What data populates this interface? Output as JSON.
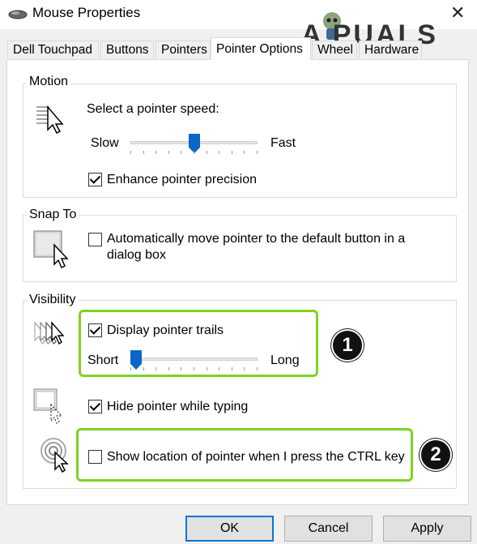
{
  "window": {
    "title": "Mouse Properties",
    "close_glyph": "✕",
    "watermark": "A PUALS"
  },
  "tabs": [
    {
      "label": "Dell Touchpad",
      "active": false
    },
    {
      "label": "Buttons",
      "active": false
    },
    {
      "label": "Pointers",
      "active": false
    },
    {
      "label": "Pointer Options",
      "active": true
    },
    {
      "label": "Wheel",
      "active": false
    },
    {
      "label": "Hardware",
      "active": false
    }
  ],
  "motion": {
    "group_label": "Motion",
    "speed_prompt": "Select a pointer speed:",
    "slow_label": "Slow",
    "fast_label": "Fast",
    "speed_level_fraction": 0.5,
    "enhance_label": "Enhance pointer precision",
    "enhance_checked": true
  },
  "snap_to": {
    "group_label": "Snap To",
    "auto_move_label_line1": "Automatically move pointer to the default button in a",
    "auto_move_label_line2": "dialog box",
    "auto_move_checked": false
  },
  "visibility": {
    "group_label": "Visibility",
    "trails_label": "Display pointer trails",
    "trails_checked": true,
    "short_label": "Short",
    "long_label": "Long",
    "trail_level_fraction": 0.0,
    "hide_label": "Hide pointer while typing",
    "hide_checked": true,
    "ctrl_label": "Show location of pointer when I press the CTRL key",
    "ctrl_checked": false
  },
  "annotations": {
    "badge1": "1",
    "badge2": "2",
    "highlight_color": "#7ed321"
  },
  "buttons": {
    "ok": "OK",
    "cancel": "Cancel",
    "apply": "Apply"
  },
  "colors": {
    "accent": "#0a66c8",
    "default_button_border": "#0078d7"
  }
}
